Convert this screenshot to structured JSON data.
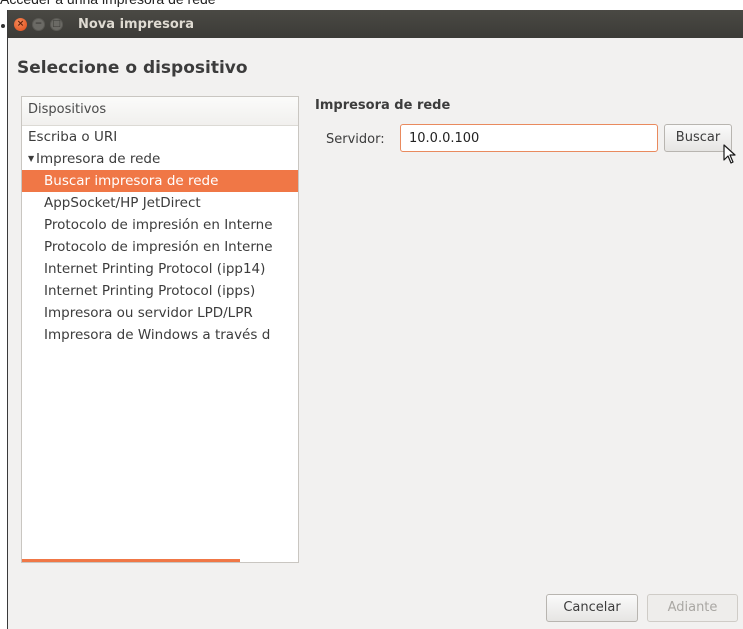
{
  "caption": "Acceder a unha impresora de rede",
  "window": {
    "title": "Nova impresora",
    "controls": {
      "close": "×",
      "minimize": "−",
      "maximize": "□"
    }
  },
  "heading": "Seleccione o dispositivo",
  "devices": {
    "header": "Dispositivos",
    "items": [
      {
        "label": "Escriba o URI"
      },
      {
        "label": "Impresora de rede",
        "expander": "▼"
      },
      {
        "label": "Buscar impresora de rede"
      },
      {
        "label": "AppSocket/HP JetDirect"
      },
      {
        "label": "Protocolo de impresión en Interne"
      },
      {
        "label": "Protocolo de impresión en Interne"
      },
      {
        "label": "Internet Printing Protocol (ipp14)"
      },
      {
        "label": "Internet Printing Protocol (ipps)"
      },
      {
        "label": "Impresora ou servidor LPD/LPR"
      },
      {
        "label": "Impresora de Windows a través d"
      }
    ]
  },
  "network": {
    "title": "Impresora de rede",
    "server_label": "Servidor:",
    "server_value": "10.0.0.100",
    "search_button": "Buscar"
  },
  "footer": {
    "cancel_button": "Cancelar",
    "next_button": "Adiante"
  },
  "colors": {
    "accent": "#f07746",
    "titlebar": "#3c3b37",
    "window_bg": "#f2f1f0"
  }
}
